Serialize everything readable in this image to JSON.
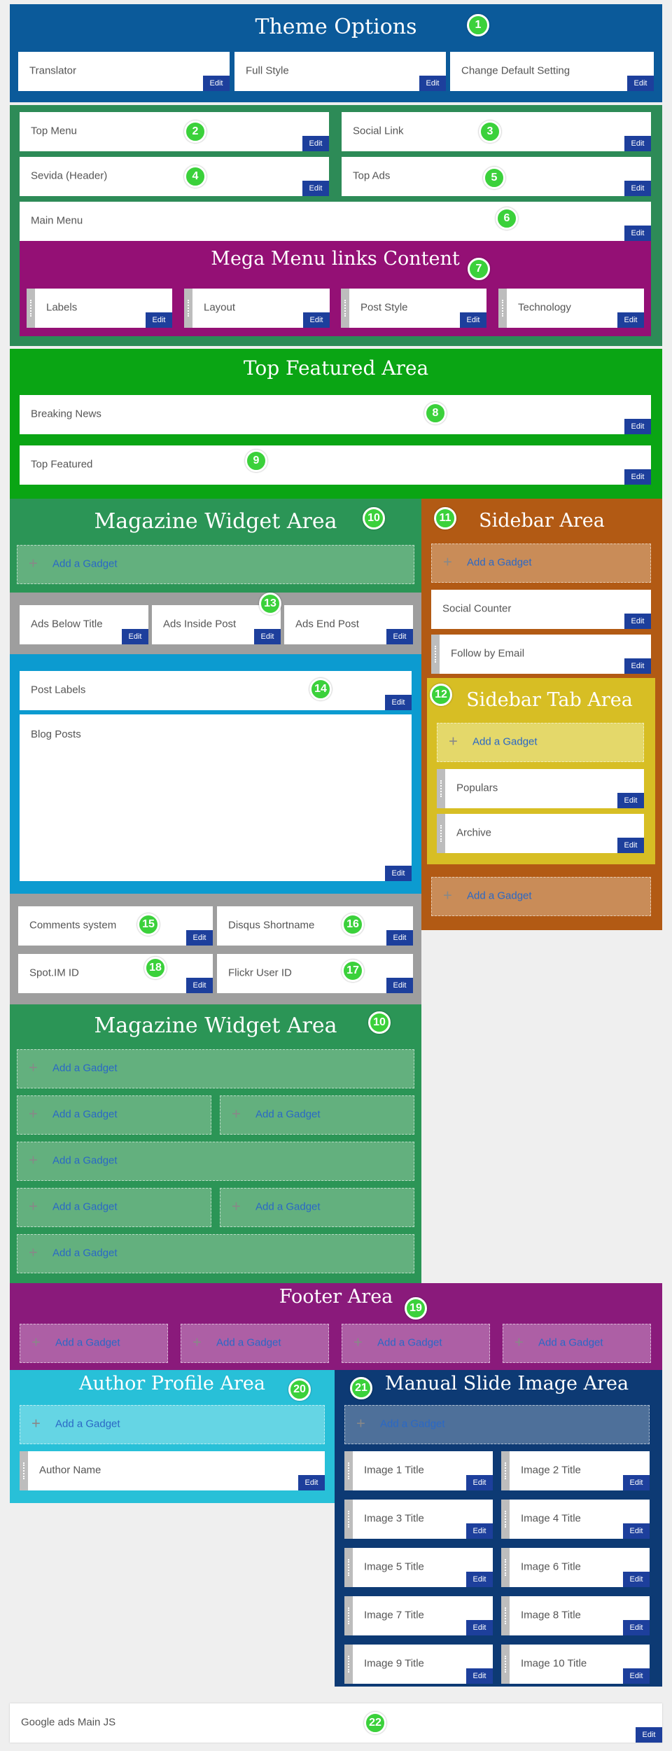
{
  "colors": {
    "theme": "#0b5a9a",
    "green": "#2d8b57",
    "mega": "#941075",
    "featured": "#0aa514",
    "magazine": "#2b9556",
    "sidebar": "#b25a14",
    "sidebartab": "#d7be24",
    "ads": "#9e9e9e",
    "blue": "#0c9bd0",
    "footer": "#8a1a7b",
    "author": "#28c0d8",
    "slide": "#0d3a74",
    "edit": "#1d3f9c",
    "badge": "#3bd13b"
  },
  "edit": "Edit",
  "add": "Add a Gadget",
  "plus": "+",
  "theme": {
    "title": "Theme Options",
    "badge": "1",
    "w": [
      "Translator",
      "Full Style",
      "Change Default Setting"
    ]
  },
  "header": {
    "top_menu": "Top Menu",
    "social": "Social Link",
    "sevida": "Sevida (Header)",
    "top_ads": "Top Ads",
    "main_menu": "Main Menu",
    "b2": "2",
    "b3": "3",
    "b4": "4",
    "b5": "5",
    "b6": "6"
  },
  "mega": {
    "title": "Mega Menu links Content",
    "badge": "7",
    "w": [
      "Labels",
      "Layout",
      "Post Style",
      "Technology"
    ]
  },
  "featured": {
    "title": "Top Featured Area",
    "w": [
      "Breaking News",
      "Top Featured"
    ],
    "b8": "8",
    "b9": "9"
  },
  "magazine": {
    "title": "Magazine Widget Area",
    "badge": "10"
  },
  "sidebar": {
    "title": "Sidebar Area",
    "badge": "11",
    "social": "Social Counter",
    "follow": "Follow by Email"
  },
  "sidebartab": {
    "title": "Sidebar Tab Area",
    "badge": "12",
    "w": [
      "Populars",
      "Archive"
    ]
  },
  "ads": {
    "badge": "13",
    "w": [
      "Ads Below Title",
      "Ads Inside Post",
      "Ads End Post"
    ]
  },
  "posts": {
    "badge": "14",
    "labels": "Post Labels",
    "blog": "Blog Posts"
  },
  "comments": {
    "w": [
      "Comments system",
      "Disqus Shortname",
      "Spot.IM ID",
      "Flickr User ID"
    ],
    "b15": "15",
    "b16": "16",
    "b17": "17",
    "b18": "18"
  },
  "footer": {
    "title": "Footer Area",
    "badge": "19"
  },
  "author": {
    "title": "Author Profile Area",
    "badge": "20",
    "name": "Author Name"
  },
  "slide": {
    "title": "Manual Slide Image Area",
    "badge": "21",
    "w": [
      "Image 1 Title",
      "Image 2 Title",
      "Image 3 Title",
      "Image 4 Title",
      "Image 5 Title",
      "Image 6 Title",
      "Image 7 Title",
      "Image 8 Title",
      "Image 9 Title",
      "Image 10 Title"
    ]
  },
  "google": {
    "label": "Google ads Main JS",
    "badge": "22"
  }
}
